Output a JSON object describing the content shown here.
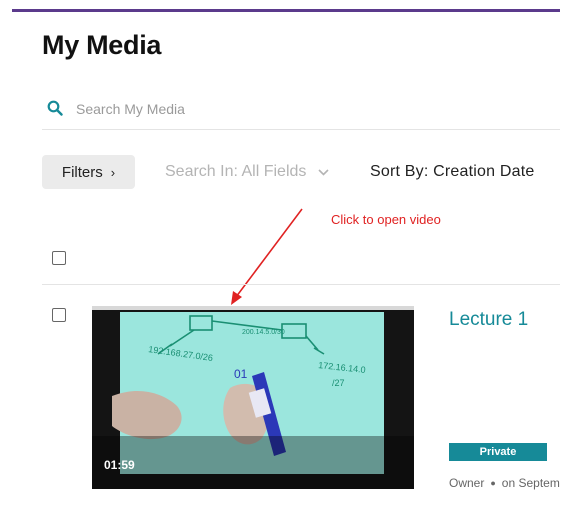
{
  "page": {
    "title": "My Media"
  },
  "search": {
    "placeholder": "Search My Media",
    "value": ""
  },
  "toolbar": {
    "filters_label": "Filters",
    "search_in_label": "Search In: All Fields",
    "sort_by_label": "Sort By: Creation Date"
  },
  "annotation": {
    "text": "Click to open video",
    "color": "#e02222"
  },
  "entries": [
    {
      "title": "Lecture 1",
      "duration": "01:59",
      "status": "Private",
      "role": "Owner",
      "date_text": "on Septem"
    }
  ],
  "colors": {
    "accent": "#168a98",
    "top_rule": "#5b3a8c"
  },
  "icons": {
    "search": "search-icon",
    "filters_chevron": "chevron-right-icon",
    "search_in_chevron": "chevron-down-icon"
  }
}
